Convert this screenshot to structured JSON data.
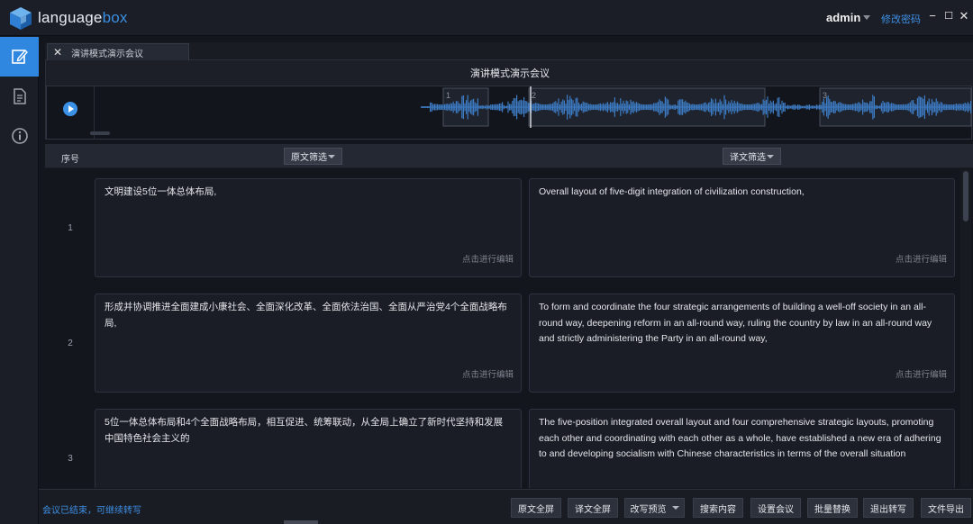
{
  "app": {
    "logo_prefix": "language",
    "logo_suffix": "box"
  },
  "header": {
    "user": "admin",
    "change_password": "修改密码",
    "min_icon": "−",
    "max_icon": "☐",
    "close_icon": "✕"
  },
  "tab": {
    "title": "演讲模式演示会议",
    "close_icon": "✕"
  },
  "meeting": {
    "title": "演讲模式演示会议",
    "segment_markers": [
      "1",
      "2",
      "3"
    ]
  },
  "table": {
    "col_no": "序号",
    "source_filter": "原文筛选",
    "target_filter": "译文筛选",
    "edit_hint": "点击进行编辑",
    "rows": [
      {
        "no": "1",
        "source": "文明建设5位一体总体布局,",
        "target": "Overall layout of five-digit integration of civilization construction,"
      },
      {
        "no": "2",
        "source": "形成并协调推进全面建成小康社会、全面深化改革、全面依法治国、全面从严治党4个全面战略布局,",
        "target": "To form and coordinate the four strategic arrangements of building a well-off society in an all-round way, deepening reform in an all-round way, ruling the country by law in an all-round way and strictly administering the Party in an all-round way,"
      },
      {
        "no": "3",
        "source": "5位一体总体布局和4个全面战略布局，相互促进、统筹联动，从全局上确立了新时代坚持和发展中国特色社会主义的",
        "target": "The five-position integrated overall layout and four comprehensive strategic layouts, promoting each other and coordinating with each other as a whole, have established a new era of adhering to and developing socialism with Chinese characteristics in terms of the overall situation"
      }
    ]
  },
  "footer": {
    "status": "会议已结束，可继续转写",
    "buttons": [
      "原文全屏",
      "译文全屏",
      "改写预览",
      "搜索内容",
      "设置会议",
      "批量替换",
      "退出转写",
      "文件导出"
    ]
  }
}
